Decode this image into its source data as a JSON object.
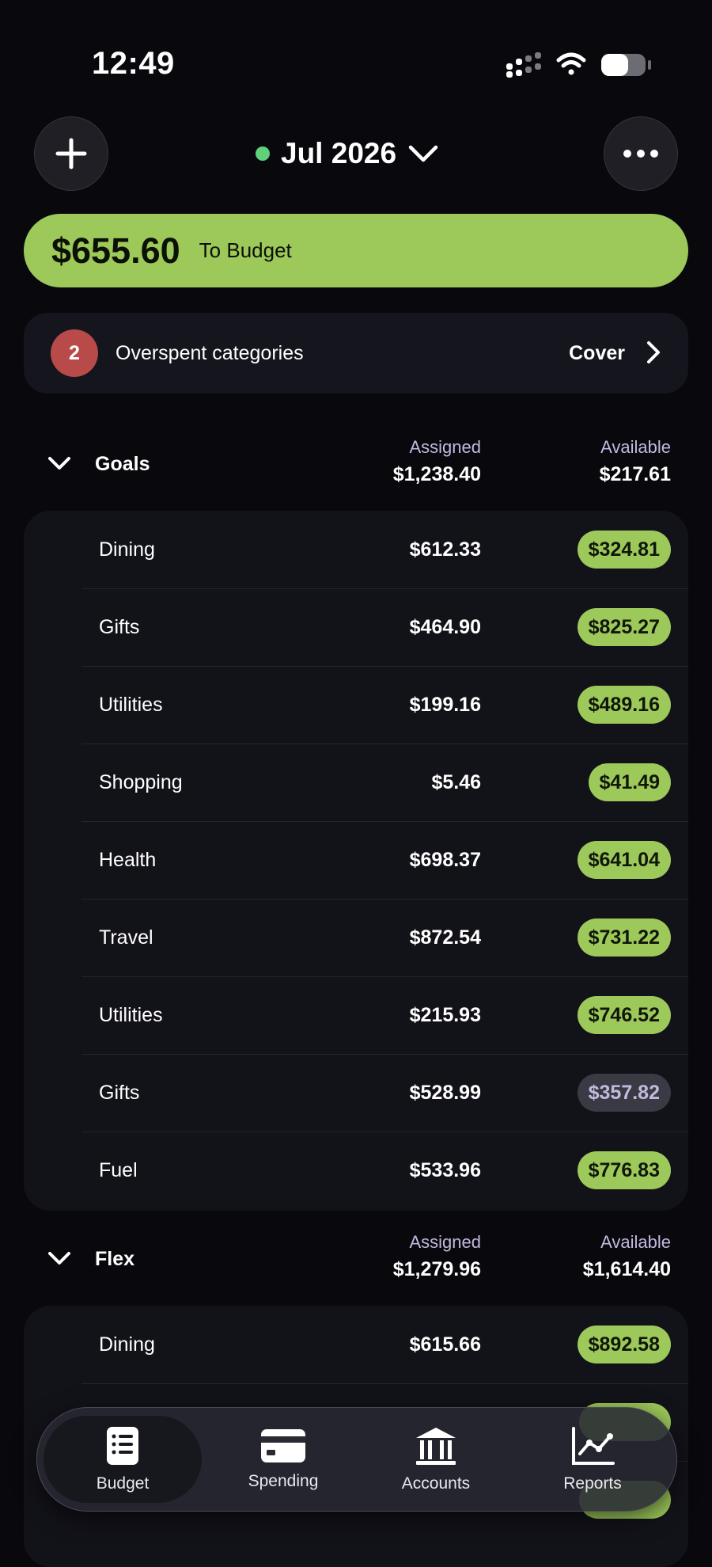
{
  "status_bar": {
    "time": "12:49"
  },
  "header": {
    "month": "Jul 2026"
  },
  "to_budget": {
    "amount": "$655.60",
    "label": "To Budget"
  },
  "overspent": {
    "count": "2",
    "label": "Overspent categories",
    "action": "Cover"
  },
  "groups": [
    {
      "title": "Goals",
      "assigned_label": "Assigned",
      "assigned": "$1,238.40",
      "available_label": "Available",
      "available": "$217.61",
      "rows": [
        {
          "name": "Dining",
          "assigned": "$612.33",
          "available": "$324.81",
          "status": "green"
        },
        {
          "name": "Gifts",
          "assigned": "$464.90",
          "available": "$825.27",
          "status": "green"
        },
        {
          "name": "Utilities",
          "assigned": "$199.16",
          "available": "$489.16",
          "status": "green"
        },
        {
          "name": "Shopping",
          "assigned": "$5.46",
          "available": "$41.49",
          "status": "green"
        },
        {
          "name": "Health",
          "assigned": "$698.37",
          "available": "$641.04",
          "status": "green"
        },
        {
          "name": "Travel",
          "assigned": "$872.54",
          "available": "$731.22",
          "status": "green"
        },
        {
          "name": "Utilities",
          "assigned": "$215.93",
          "available": "$746.52",
          "status": "green"
        },
        {
          "name": "Gifts",
          "assigned": "$528.99",
          "available": "$357.82",
          "status": "gray"
        },
        {
          "name": "Fuel",
          "assigned": "$533.96",
          "available": "$776.83",
          "status": "green"
        }
      ]
    },
    {
      "title": "Flex",
      "assigned_label": "Assigned",
      "assigned": "$1,279.96",
      "available_label": "Available",
      "available": "$1,614.40",
      "rows": [
        {
          "name": "Dining",
          "assigned": "$615.66",
          "available": "$892.58",
          "status": "green"
        }
      ]
    }
  ],
  "tabs": [
    {
      "label": "Budget",
      "icon": "list-doc-icon",
      "active": true
    },
    {
      "label": "Spending",
      "icon": "card-icon",
      "active": false
    },
    {
      "label": "Accounts",
      "icon": "bank-icon",
      "active": false
    },
    {
      "label": "Reports",
      "icon": "chart-icon",
      "active": false
    }
  ],
  "colors": {
    "background": "#08080d",
    "accent_green": "#9dc85a",
    "danger_red": "#b84a4a",
    "muted_purple": "#c3b7df"
  }
}
